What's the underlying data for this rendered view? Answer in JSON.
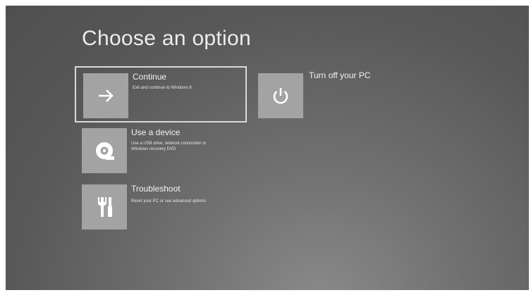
{
  "screen": {
    "title": "Choose an option"
  },
  "options": [
    {
      "id": "continue",
      "label": "Continue",
      "description": "Exit and continue to Windows 8",
      "icon": "arrow-right-icon",
      "selected": true
    },
    {
      "id": "use-device",
      "label": "Use a device",
      "description_line1": "Use a USB drive, network connection or",
      "description_line2": "Windows recovery DVD",
      "icon": "disc-icon"
    },
    {
      "id": "troubleshoot",
      "label": "Troubleshoot",
      "description": "Reset your PC or see advanced options",
      "icon": "tools-icon"
    },
    {
      "id": "turn-off",
      "label": "Turn off your PC",
      "icon": "power-icon"
    }
  ],
  "colors": {
    "background": "#5a5a5a",
    "tile": "#a3a3a3",
    "text": "#f2f2f2",
    "selection_border": "#d9d9d9"
  }
}
